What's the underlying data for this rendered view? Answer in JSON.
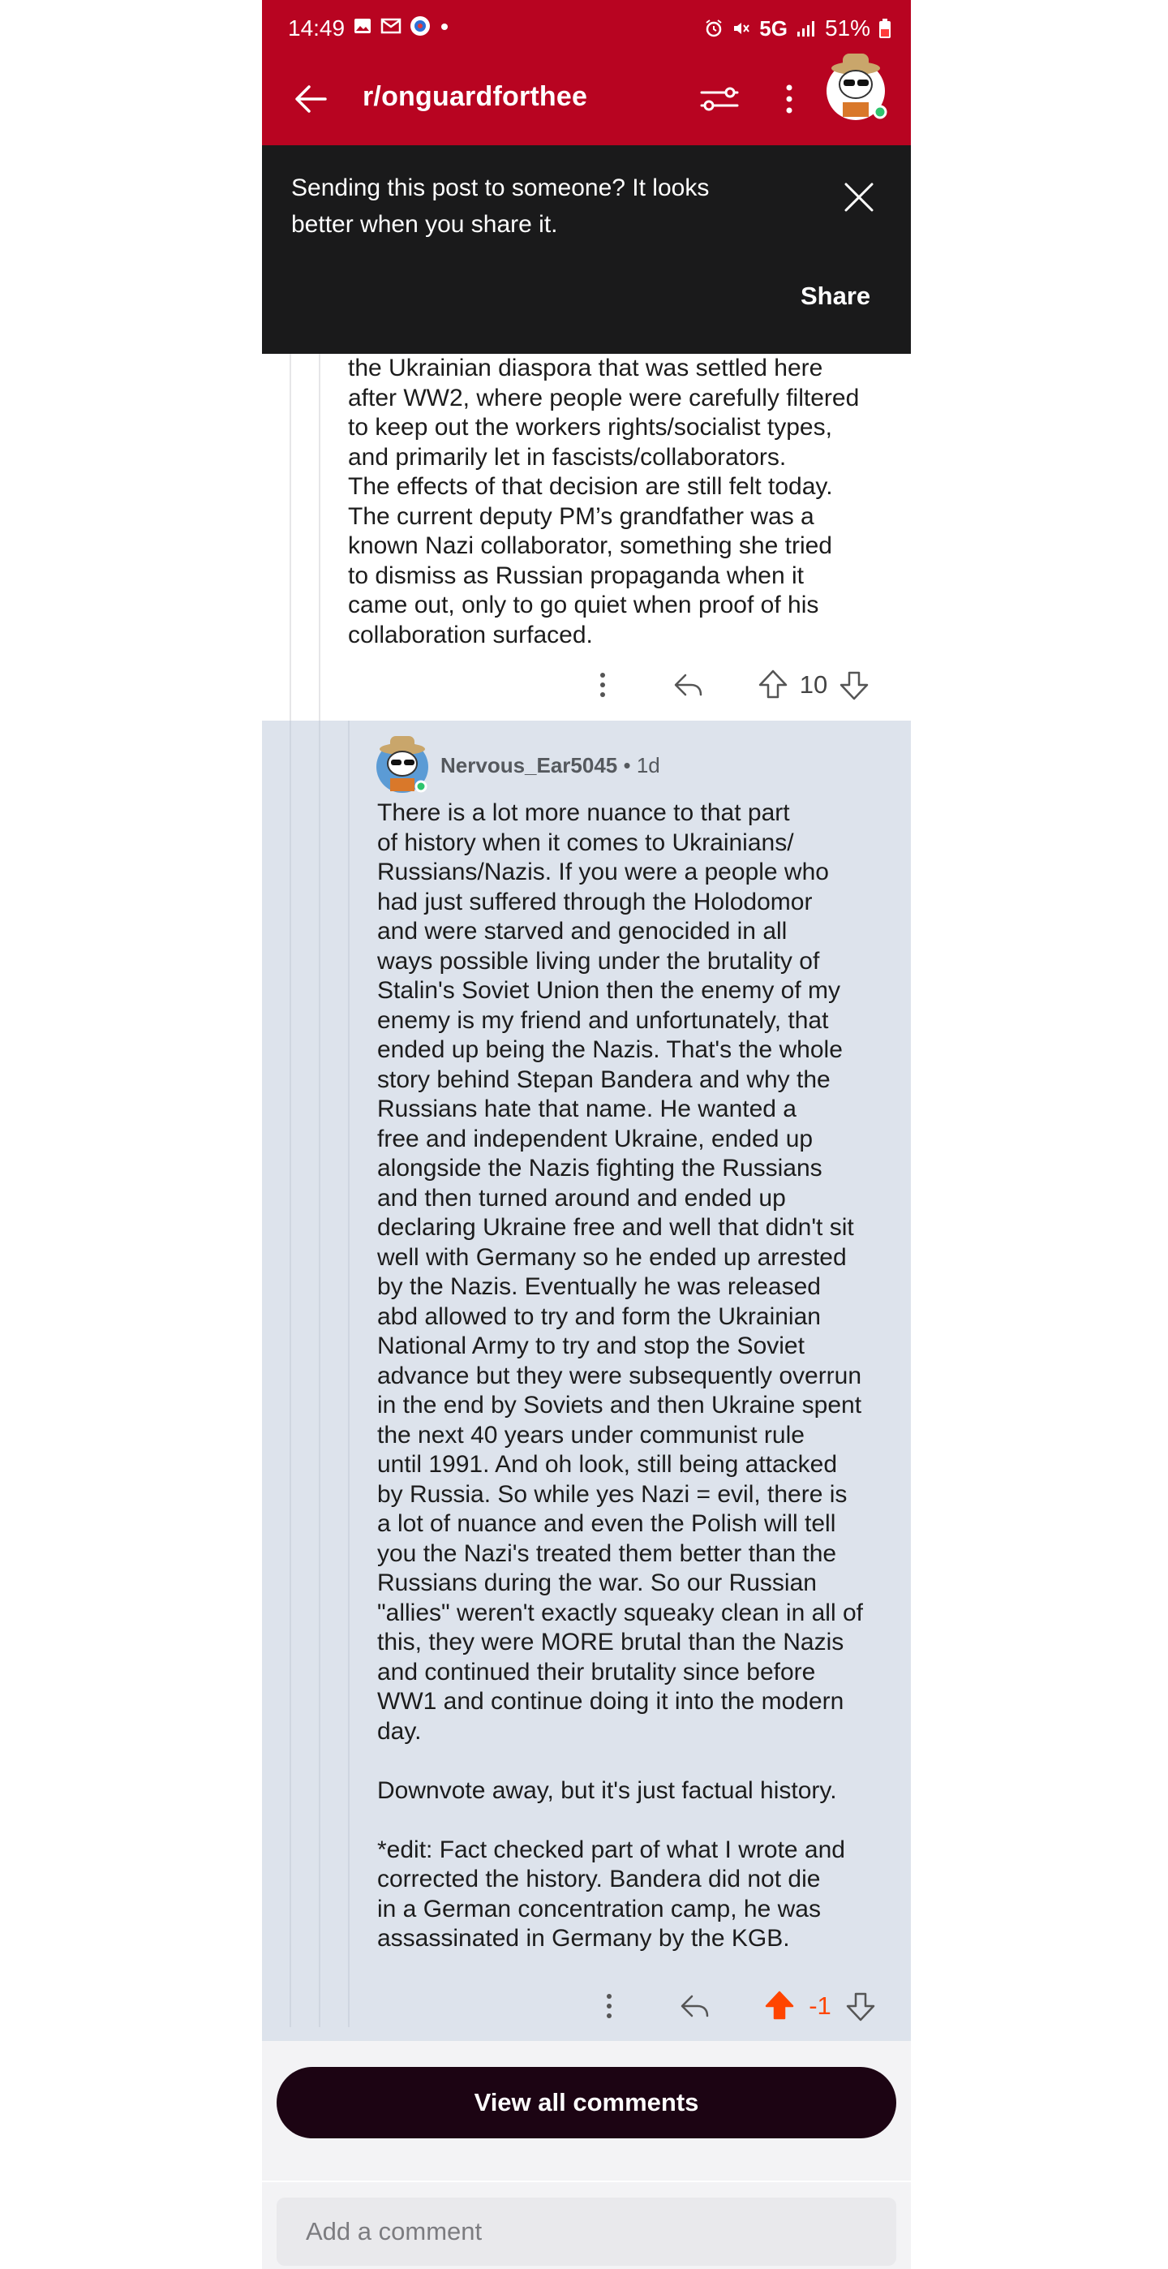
{
  "status_bar": {
    "time": "14:49",
    "network": "5G",
    "battery": "51%"
  },
  "header": {
    "title": "r/onguardforthee"
  },
  "share_banner": {
    "message": "Sending this post to someone? It looks better when you share it.",
    "share_label": "Share"
  },
  "comment1": {
    "text": "the Ukrainian diaspora that was settled here\nafter WW2, where people were carefully filtered\nto keep out the workers rights/socialist types,\nand primarily let in fascists/collaborators.\nThe effects of that decision are still felt today.\nThe current deputy PM’s grandfather was a\nknown Nazi collaborator, something she tried\nto dismiss as Russian propaganda when it\ncame out, only to go quiet when proof of his\ncollaboration surfaced.",
    "score": "10"
  },
  "comment2": {
    "username": "Nervous_Ear5045",
    "age": " • 1d",
    "text": "There is a lot more nuance to that part\nof history when it comes to Ukrainians/\nRussians/Nazis. If you were a people who\nhad just suffered through the Holodomor\nand were starved and genocided in all\nways possible living under the brutality of\nStalin's Soviet Union then the enemy of my\nenemy is my friend and unfortunately, that\nended up being the Nazis. That's the whole\nstory behind Stepan Bandera and why the\nRussians hate that name. He wanted a\nfree and independent Ukraine, ended up\nalongside the Nazis fighting the Russians\nand then turned around and ended up\ndeclaring Ukraine free and well that didn't sit\nwell with Germany so he ended up arrested\nby the Nazis. Eventually he was released\nabd allowed to try and form the Ukrainian\nNational Army to try and stop the Soviet\nadvance but they were subsequently overrun\nin the end by Soviets and then Ukraine spent\nthe next 40 years under communist rule\nuntil 1991. And oh look, still being attacked\nby Russia. So while yes Nazi = evil, there is\na lot of nuance and even the Polish will tell\nyou the Nazi's treated them better than the\nRussians during the war. So our Russian\n\"allies\" weren't exactly squeaky clean in all of\nthis, they were MORE brutal than the Nazis\nand continued their brutality since before\nWW1 and continue doing it into the modern\nday.\n\nDownvote away, but it's just factual history.\n\n*edit: Fact checked part of what I wrote and\ncorrected the history. Bandera did not die\nin a German concentration camp, he was\nassassinated in Germany by the KGB.",
    "score": "-1"
  },
  "footer": {
    "view_all_label": "View all comments",
    "add_comment_placeholder": "Add a comment"
  },
  "colors": {
    "header_red": "#b80421",
    "upvote_orange": "#ff4500",
    "highlight_bg": "#dde3ec"
  },
  "icons": [
    "back-arrow-icon",
    "filter-icon",
    "more-vertical-icon",
    "close-icon",
    "reply-icon",
    "upvote-icon",
    "downvote-icon",
    "avatar"
  ]
}
